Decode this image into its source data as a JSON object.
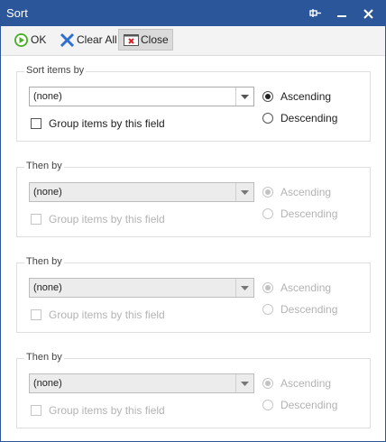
{
  "window": {
    "title": "Sort"
  },
  "titlebar_buttons": [
    "pin-icon",
    "minimize-icon",
    "close-icon"
  ],
  "toolbar": {
    "ok_label": "OK",
    "clear_all_label": "Clear All",
    "close_label": "Close"
  },
  "groups": [
    {
      "legend": "Sort items by",
      "value": "(none)",
      "group_label": "Group items by this field",
      "ascending": "Ascending",
      "descending": "Descending",
      "enabled": true,
      "selected": "ascending"
    },
    {
      "legend": "Then by",
      "value": "(none)",
      "group_label": "Group items by this field",
      "ascending": "Ascending",
      "descending": "Descending",
      "enabled": false,
      "selected": "ascending"
    },
    {
      "legend": "Then by",
      "value": "(none)",
      "group_label": "Group items by this field",
      "ascending": "Ascending",
      "descending": "Descending",
      "enabled": false,
      "selected": "ascending"
    },
    {
      "legend": "Then by",
      "value": "(none)",
      "group_label": "Group items by this field",
      "ascending": "Ascending",
      "descending": "Descending",
      "enabled": false,
      "selected": "ascending"
    }
  ],
  "colors": {
    "titlebar": "#2b579a",
    "ok_icon": "#4caf28",
    "clear_icon": "#2f6fd0",
    "close_icon": "#d9262b"
  }
}
